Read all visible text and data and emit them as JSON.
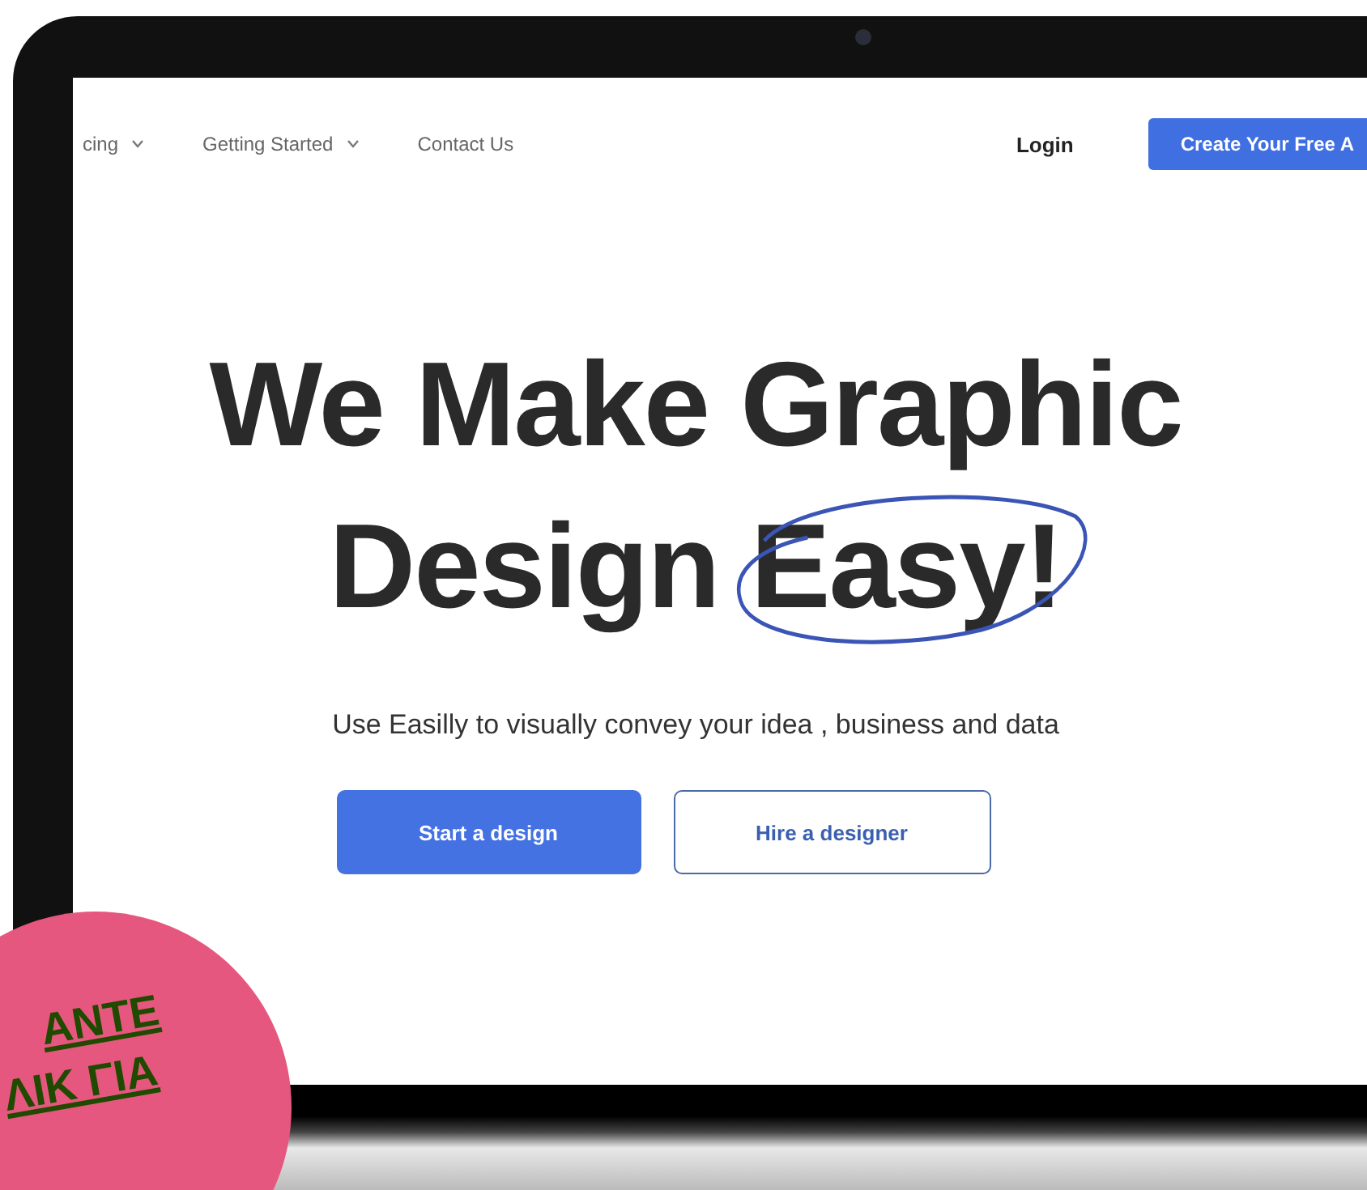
{
  "nav": {
    "items": [
      {
        "label": "cing",
        "has_dropdown": true
      },
      {
        "label": "Getting Started",
        "has_dropdown": true
      },
      {
        "label": "Contact Us",
        "has_dropdown": false
      }
    ],
    "login": "Login",
    "signup_button": "Create Your Free A"
  },
  "hero": {
    "title_line_1": "We Make Graphic",
    "title_line_2_start": "Design",
    "title_line_2_circled": "Easy!",
    "subtitle": "Use Easilly to visually convey your idea , business and data",
    "buttons": [
      {
        "label": "Start a design",
        "kind": "primary"
      },
      {
        "label": "Hire a designer",
        "kind": "outline"
      }
    ]
  },
  "badge": {
    "lines": [
      "ANTE",
      "ΛΙΚ ΓΙΑ"
    ]
  }
}
